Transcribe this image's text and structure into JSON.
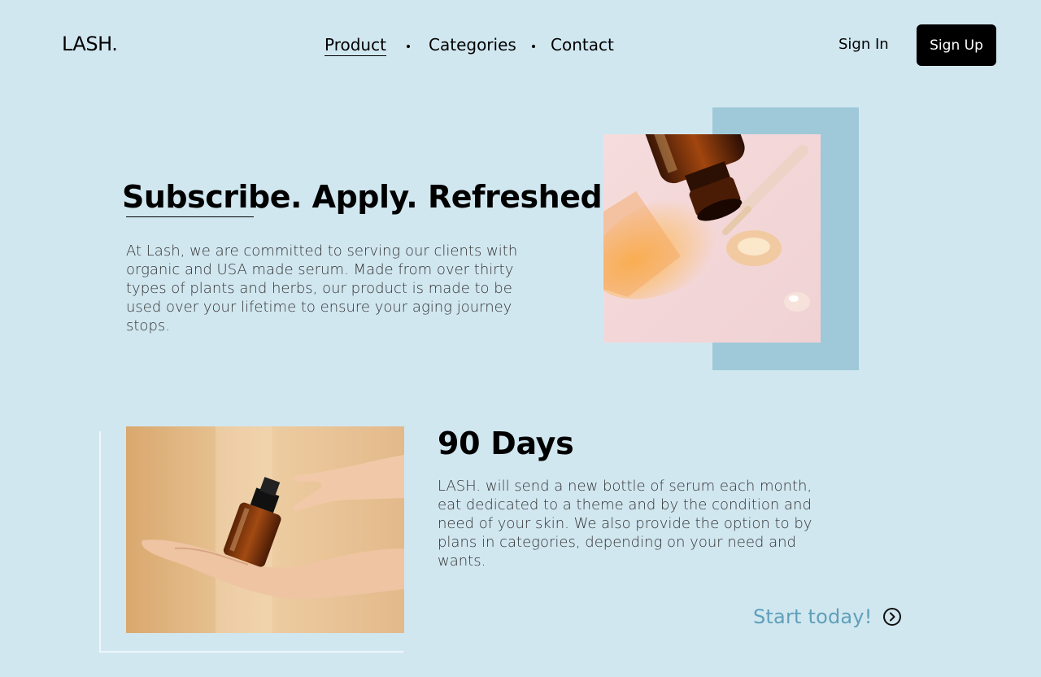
{
  "header": {
    "logo": "LASH.",
    "nav": [
      {
        "label": "Product",
        "active": true
      },
      {
        "label": "Categories"
      },
      {
        "label": "Contact"
      }
    ],
    "sign_in": "Sign In",
    "sign_up": "Sign Up"
  },
  "hero": {
    "title_word1": "Subscribe",
    "title_rest": ". Apply. Refreshed.",
    "body": "At Lash, we are committed to serving our clients with organic and USA made serum. Made from over thirty types of plants and herbs, our product is made to be used over your lifetime to ensure your aging journey stops."
  },
  "feature": {
    "title": "90 Days",
    "body": "LASH. will send a new bottle of serum each month, eat dedicated to a theme and by the condition and need of your skin. We also provide the option to by plans in categories, depending on your need and wants.",
    "cta": "Start today!"
  },
  "colors": {
    "background": "#d1e7f0",
    "frame_accent": "#9fc9d9",
    "cta": "#5f9fb9",
    "button": "#000000"
  }
}
